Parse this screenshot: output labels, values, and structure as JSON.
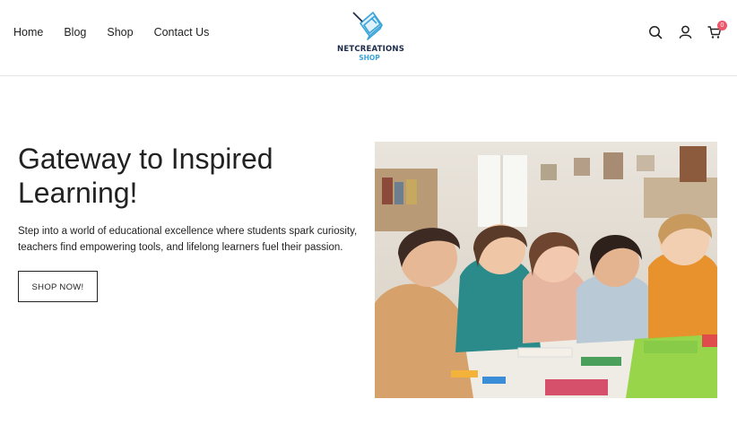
{
  "nav": {
    "items": [
      {
        "label": "Home"
      },
      {
        "label": "Blog"
      },
      {
        "label": "Shop"
      },
      {
        "label": "Contact Us"
      }
    ]
  },
  "logo": {
    "line1": "NETCREATIONS",
    "line2": "SHOP",
    "icon": "book-logo-icon",
    "colors": {
      "dark": "#1a2a48",
      "accent": "#3aa3d9"
    }
  },
  "header_icons": {
    "search": "search-icon",
    "account": "user-icon",
    "cart": "cart-icon",
    "cart_count": "0",
    "badge_color": "#f0566a"
  },
  "hero": {
    "title": "Gateway to Inspired Learning!",
    "description": "Step into a world of educational excellence where students spark curiosity, teachers find empowering tools, and lifelong learners fuel their passion.",
    "button_label": "SHOP NOW!",
    "image": "children-drawing-classroom-photo"
  }
}
